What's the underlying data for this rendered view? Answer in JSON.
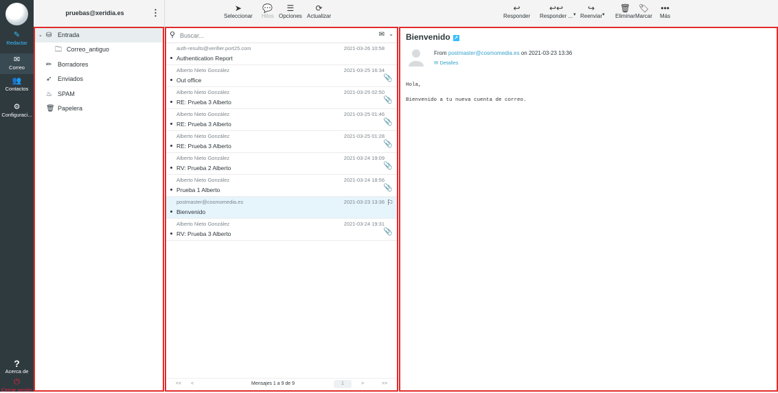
{
  "rail": {
    "compose": "Redactar",
    "mail": "Correo",
    "contacts": "Contactos",
    "settings": "Configuraci...",
    "about": "Acerca de",
    "logout": "Cerrar sesión"
  },
  "account": {
    "name": "pruebas@xeridia.es"
  },
  "toolbar_list": {
    "select": "Seleccionar",
    "threads": "Hilos",
    "options": "Opciones",
    "refresh": "Actualizar"
  },
  "toolbar_msg": {
    "reply": "Responder",
    "reply_all": "Responder ...",
    "forward": "Reenviar",
    "delete": "Eliminar",
    "mark": "Marcar",
    "more": "Más"
  },
  "folders": [
    {
      "label": "Entrada",
      "icon": "inbox-icon"
    },
    {
      "label": "Correo_antiguo",
      "icon": "folder-icon"
    },
    {
      "label": "Borradores",
      "icon": "pencil-icon"
    },
    {
      "label": "Enviados",
      "icon": "paper-plane-icon"
    },
    {
      "label": "SPAM",
      "icon": "fire-icon"
    },
    {
      "label": "Papelera",
      "icon": "trash-icon"
    }
  ],
  "search": {
    "placeholder": "Buscar..."
  },
  "messages": [
    {
      "from": "auth-results@verifier.port25.com",
      "date": "2021-03-26 10:58",
      "subject": "Authentication Report"
    },
    {
      "from": "Alberto Nieto González",
      "date": "2021-03-25 16:34",
      "subject": "Out office"
    },
    {
      "from": "Alberto Nieto González",
      "date": "2021-03-25 02:50",
      "subject": "RE: Prueba 3 Alberto"
    },
    {
      "from": "Alberto Nieto González",
      "date": "2021-03-25 01:46",
      "subject": "RE: Prueba 3 Alberto"
    },
    {
      "from": "Alberto Nieto González",
      "date": "2021-03-25 01:28",
      "subject": "RE: Prueba 3 Alberto"
    },
    {
      "from": "Alberto Nieto González",
      "date": "2021-03-24 19:09",
      "subject": "RV: Prueba 2 Alberto"
    },
    {
      "from": "Alberto Nieto González",
      "date": "2021-03-24 18:56",
      "subject": "Prueba 1 Alberto"
    },
    {
      "from": "postmaster@cosmomedia.es",
      "date": "2021-03-23 13:36",
      "subject": "Bienvenido"
    },
    {
      "from": "Alberto Nieto González",
      "date": "2021-03-24 19:31",
      "subject": "RV: Prueba 3 Alberto"
    }
  ],
  "pager": {
    "first": "<<",
    "prev": "<",
    "status": "Mensajes 1 a 9 de 9",
    "page": "1",
    "next": ">",
    "last": ">>"
  },
  "preview": {
    "title": "Bienvenido",
    "from_prefix": "From",
    "from_addr": "postmaster@cosmomedia.es",
    "date_text": "on 2021-03-23 13:36",
    "details": "Detalles",
    "body_line1": "Hola,",
    "body_line2": "Bienvenido a tu nueva cuenta de correo."
  },
  "colors": {
    "accent": "#37beff",
    "panel_border": "#e22a2a",
    "rail_bg": "#2f3a3f"
  }
}
